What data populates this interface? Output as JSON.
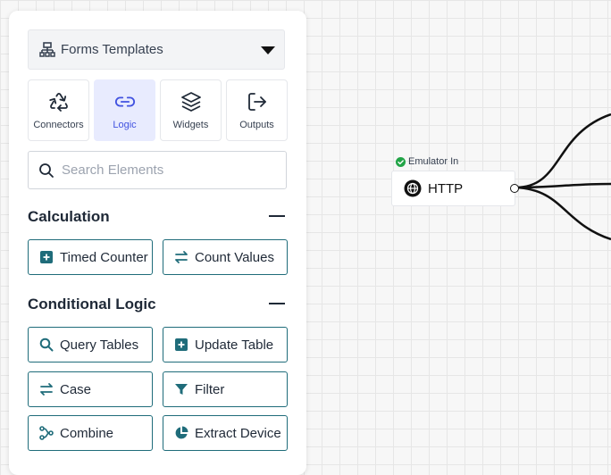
{
  "template_select": {
    "label": "Forms Templates",
    "icon": "sitemap-icon"
  },
  "tabs": [
    {
      "label": "Connectors",
      "icon": "recycle-icon",
      "active": false
    },
    {
      "label": "Logic",
      "icon": "link-icon",
      "active": true
    },
    {
      "label": "Widgets",
      "icon": "layers-icon",
      "active": false
    },
    {
      "label": "Outputs",
      "icon": "sign-out-icon",
      "active": false
    }
  ],
  "search": {
    "placeholder": "Search Elements",
    "value": ""
  },
  "sections": [
    {
      "title": "Calculation",
      "items": [
        {
          "label": "Timed Counter",
          "icon": "plus-square-icon"
        },
        {
          "label": "Count Values",
          "icon": "swap-icon"
        }
      ]
    },
    {
      "title": "Conditional Logic",
      "items": [
        {
          "label": "Query Tables",
          "icon": "search-icon"
        },
        {
          "label": "Update Table",
          "icon": "plus-square-icon"
        },
        {
          "label": "Case",
          "icon": "swap-icon"
        },
        {
          "label": "Filter",
          "icon": "filter-icon"
        },
        {
          "label": "Combine",
          "icon": "merge-icon"
        },
        {
          "label": "Extract Device",
          "icon": "pie-chart-icon"
        }
      ]
    }
  ],
  "canvas": {
    "node": {
      "status": "Emulator In",
      "label": "HTTP",
      "icon": "globe-icon"
    }
  },
  "colors": {
    "accent": "#4152e0",
    "teal": "#1f6c7a",
    "success": "#22a447"
  }
}
